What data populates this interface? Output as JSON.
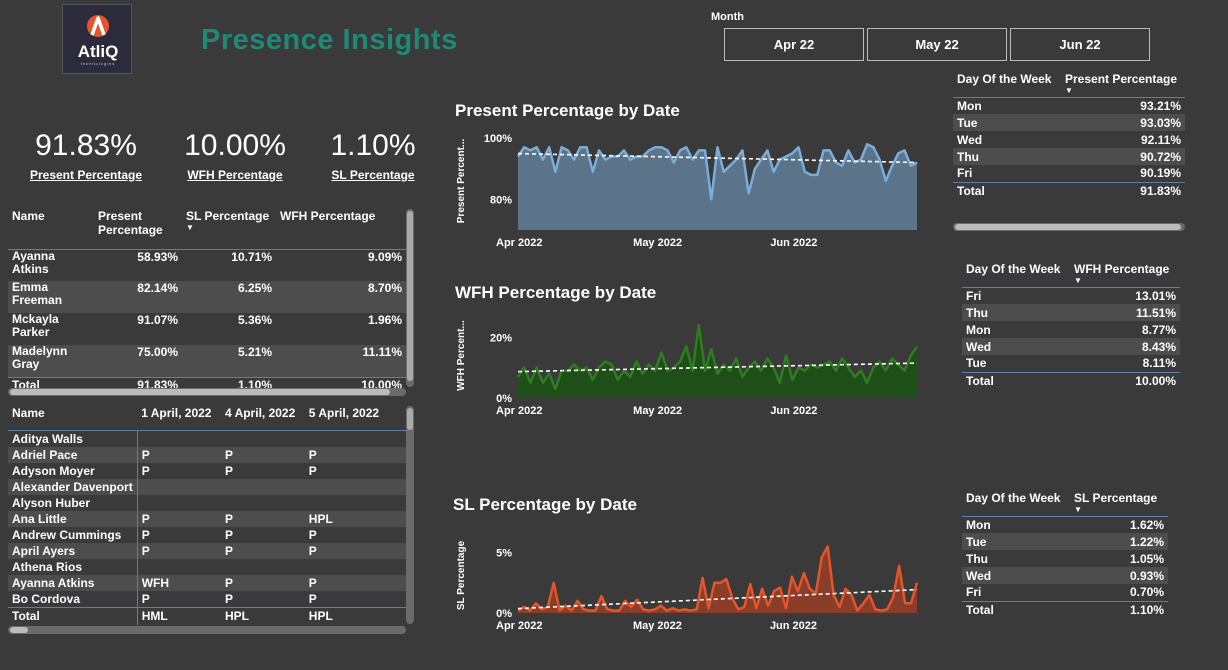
{
  "logo": {
    "name": "AtliQ",
    "subtitle": "technologies"
  },
  "title": "Presence Insights",
  "month_slicer": {
    "label": "Month",
    "options": [
      "Apr 22",
      "May 22",
      "Jun 22"
    ]
  },
  "kpis": [
    {
      "value": "91.83%",
      "label": "Present Percentage"
    },
    {
      "value": "10.00%",
      "label": "WFH Percentage"
    },
    {
      "value": "1.10%",
      "label": "SL Percentage"
    }
  ],
  "employee_table": {
    "headers": [
      "Name",
      "Present Percentage",
      "SL Percentage",
      "WFH Percentage"
    ],
    "rows": [
      [
        "Ayanna Atkins",
        "58.93%",
        "10.71%",
        "9.09%"
      ],
      [
        "Emma Freeman",
        "82.14%",
        "6.25%",
        "8.70%"
      ],
      [
        "Mckayla Parker",
        "91.07%",
        "5.36%",
        "1.96%"
      ],
      [
        "Madelynn Gray",
        "75.00%",
        "5.21%",
        "11.11%"
      ]
    ],
    "total": [
      "Total",
      "91.83%",
      "1.10%",
      "10.00%"
    ]
  },
  "attendance_matrix": {
    "headers": [
      "Name",
      "1 April, 2022",
      "4 April, 2022",
      "5 April, 2022"
    ],
    "rows": [
      [
        "Aditya Walls",
        "",
        "",
        ""
      ],
      [
        "Adriel Pace",
        "P",
        "P",
        "P"
      ],
      [
        "Adyson Moyer",
        "P",
        "P",
        "P"
      ],
      [
        "Alexander Davenport",
        "",
        "",
        ""
      ],
      [
        "Alyson Huber",
        "",
        "",
        ""
      ],
      [
        "Ana Little",
        "P",
        "P",
        "HPL"
      ],
      [
        "Andrew Cummings",
        "P",
        "P",
        "P"
      ],
      [
        "April Ayers",
        "P",
        "P",
        "P"
      ],
      [
        "Athena Rios",
        "",
        "",
        ""
      ],
      [
        "Ayanna Atkins",
        "WFH",
        "P",
        "P"
      ],
      [
        "Bo Cordova",
        "P",
        "P",
        "P"
      ]
    ],
    "total": [
      "Total",
      "HML",
      "HPL",
      "HPL"
    ]
  },
  "dow_present": {
    "headers": [
      "Day Of the Week",
      "Present Percentage"
    ],
    "rows": [
      [
        "Mon",
        "93.21%"
      ],
      [
        "Tue",
        "93.03%"
      ],
      [
        "Wed",
        "92.11%"
      ],
      [
        "Thu",
        "90.72%"
      ],
      [
        "Fri",
        "90.19%"
      ]
    ],
    "total": [
      "Total",
      "91.83%"
    ]
  },
  "dow_wfh": {
    "headers": [
      "Day Of the Week",
      "WFH Percentage"
    ],
    "rows": [
      [
        "Fri",
        "13.01%"
      ],
      [
        "Thu",
        "11.51%"
      ],
      [
        "Mon",
        "8.77%"
      ],
      [
        "Wed",
        "8.43%"
      ],
      [
        "Tue",
        "8.11%"
      ]
    ],
    "total": [
      "Total",
      "10.00%"
    ]
  },
  "dow_sl": {
    "headers": [
      "Day Of the Week",
      "SL Percentage"
    ],
    "rows": [
      [
        "Mon",
        "1.62%"
      ],
      [
        "Tue",
        "1.22%"
      ],
      [
        "Thu",
        "1.05%"
      ],
      [
        "Wed",
        "0.93%"
      ],
      [
        "Fri",
        "0.70%"
      ]
    ],
    "total": [
      "Total",
      "1.10%"
    ]
  },
  "colors": {
    "present": "#7aaed8",
    "present_fill": "#5b7489",
    "wfh": "#2e7d1f",
    "wfh_fill": "#1f4f18",
    "sl": "#e4552b",
    "sl_fill": "#8a3e2a",
    "accent": "#1e8a76"
  },
  "chart_data": [
    {
      "type": "area",
      "title": "Present Percentage by Date",
      "ylabel": "Present Percent...",
      "x_ticks": [
        "Apr 2022",
        "May 2022",
        "Jun 2022"
      ],
      "y_ticks": [
        "100%",
        "80%"
      ],
      "ylim": [
        70,
        102
      ],
      "trendline": true,
      "values": [
        94,
        97,
        96,
        97,
        93,
        97,
        89,
        97,
        96,
        93,
        97,
        97,
        89,
        96,
        93,
        94,
        94,
        96,
        93,
        94,
        94,
        96,
        97,
        97,
        96,
        92,
        96,
        97,
        93,
        96,
        96,
        80,
        97,
        89,
        91,
        93,
        96,
        82,
        90,
        93,
        96,
        89,
        93,
        94,
        95,
        97,
        89,
        88,
        88,
        96,
        96,
        92,
        91,
        96,
        92,
        93,
        98,
        97,
        93,
        86,
        91,
        95,
        96,
        91,
        92
      ]
    },
    {
      "type": "area",
      "title": "WFH Percentage by Date",
      "ylabel": "WFH Percent...",
      "x_ticks": [
        "Apr 2022",
        "May 2022",
        "Jun 2022"
      ],
      "y_ticks": [
        "20%",
        "0%"
      ],
      "ylim": [
        0,
        28
      ],
      "trendline": true,
      "values": [
        7,
        10,
        5,
        10,
        5,
        8,
        3,
        9,
        9,
        11,
        9,
        10,
        6,
        10,
        12,
        11,
        6,
        9,
        7,
        12,
        8,
        11,
        9,
        15,
        9,
        10,
        12,
        17,
        9,
        24,
        9,
        16,
        8,
        11,
        9,
        13,
        7,
        10,
        12,
        9,
        13,
        10,
        5,
        14,
        6,
        10,
        9,
        11,
        10,
        11,
        12,
        9,
        13,
        10,
        7,
        9,
        5,
        10,
        12,
        9,
        13,
        11,
        9,
        14,
        17
      ]
    },
    {
      "type": "area",
      "title": "SL Percentage by Date",
      "ylabel": "SL Percentage",
      "x_ticks": [
        "Apr 2022",
        "May 2022",
        "Jun 2022"
      ],
      "y_ticks": [
        "5%",
        "0%"
      ],
      "ylim": [
        0,
        6.2
      ],
      "trendline": true,
      "values": [
        0.2,
        0.5,
        0.2,
        0.8,
        0.3,
        0.5,
        2.5,
        0.2,
        0.6,
        0.2,
        1.0,
        0.3,
        0.2,
        0.2,
        1.4,
        0.3,
        0.2,
        0.2,
        1.0,
        0.5,
        1.1,
        0.3,
        0.2,
        0.3,
        0.6,
        0.2,
        0.4,
        0.2,
        0.3,
        0.2,
        0.3,
        2.9,
        0.4,
        2.5,
        2.5,
        2.8,
        1.2,
        0.3,
        0.5,
        2.4,
        0.4,
        2.0,
        0.6,
        1.8,
        2.1,
        0.4,
        3.0,
        1.8,
        3.3,
        2.0,
        1.6,
        4.6,
        5.5,
        1.5,
        0.5,
        2.0,
        1.5,
        0.2,
        0.8,
        1.5,
        0.3,
        0.2,
        0.3,
        1.3,
        3.9,
        0.8,
        0.8,
        2.5
      ]
    }
  ]
}
